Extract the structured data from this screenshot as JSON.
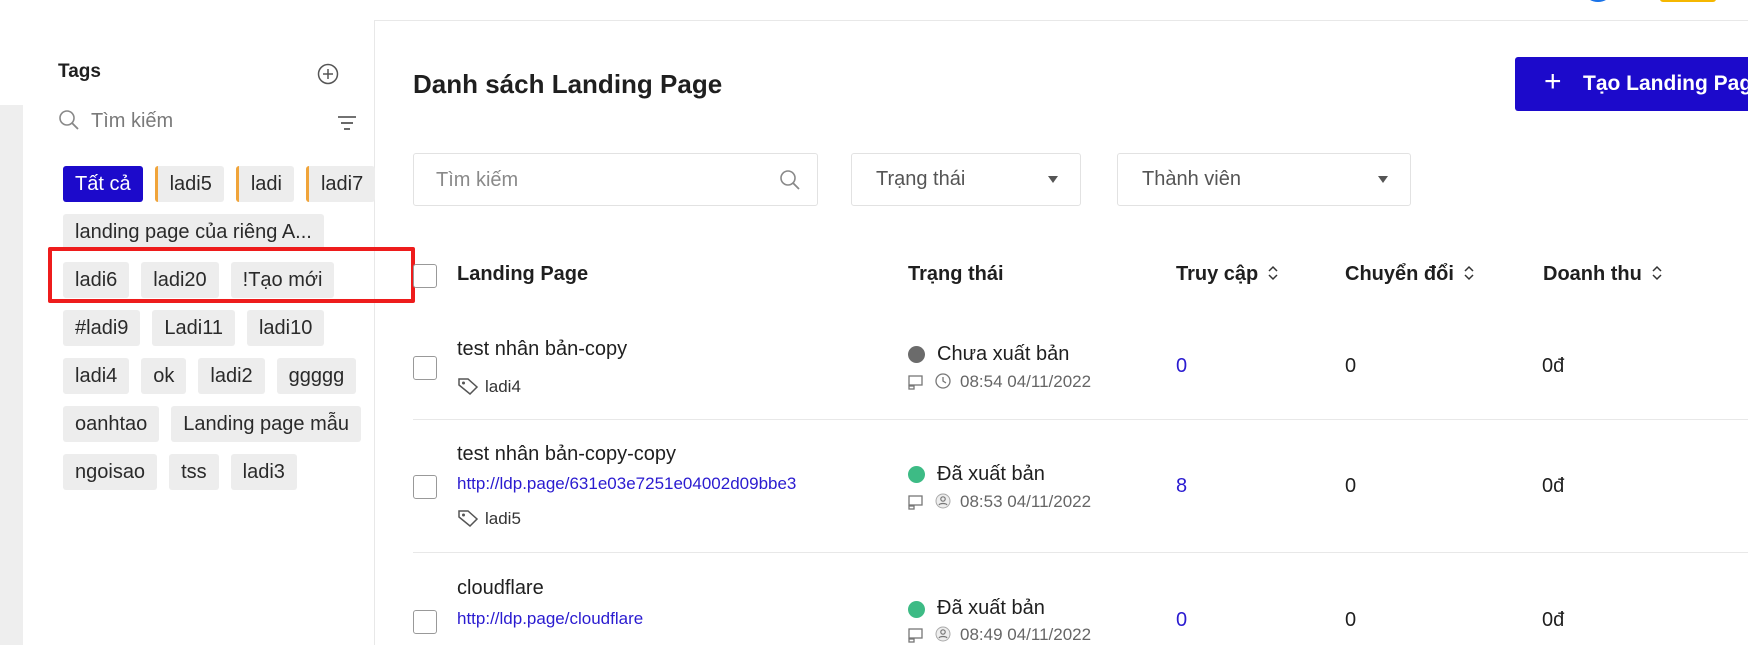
{
  "sidebar": {
    "title": "Tags",
    "search_placeholder": "Tìm kiếm",
    "tags": [
      {
        "label": "Tất cả",
        "active": true
      },
      {
        "label": "ladi5",
        "marked": true
      },
      {
        "label": "ladi",
        "marked": true
      },
      {
        "label": "ladi7",
        "marked": true
      },
      {
        "label": "landing page của riêng A...",
        "wide": true
      },
      {
        "label": "ladi6"
      },
      {
        "label": "ladi20"
      },
      {
        "label": "!Tạo mới"
      },
      {
        "label": "#ladi9"
      },
      {
        "label": "Ladi11"
      },
      {
        "label": "ladi10"
      },
      {
        "label": "ladi4"
      },
      {
        "label": "ok"
      },
      {
        "label": "ladi2"
      },
      {
        "label": "ggggg"
      },
      {
        "label": "oanhtao"
      },
      {
        "label": "Landing page mẫu"
      },
      {
        "label": "ngoisao"
      },
      {
        "label": "tss"
      },
      {
        "label": "ladi3"
      }
    ]
  },
  "header": {
    "title": "Danh sách Landing Page",
    "create_label": "Tạo Landing Page"
  },
  "filters": {
    "search_placeholder": "Tìm kiếm",
    "status_label": "Trạng thái",
    "member_label": "Thành viên"
  },
  "table": {
    "columns": {
      "landing_page": "Landing Page",
      "status": "Trạng thái",
      "visits": "Truy cập",
      "conversions": "Chuyển đổi",
      "revenue": "Doanh thu"
    },
    "rows": [
      {
        "name": "test nhân bản-copy",
        "url": "",
        "tag": "ladi4",
        "status": "Chưa xuất bản",
        "status_color": "#6b6b6b",
        "time": "08:54 04/11/2022",
        "meta_icon": "history-icon",
        "visits": "0",
        "conversions": "0",
        "revenue": "0đ"
      },
      {
        "name": "test nhân bản-copy-copy",
        "url": "http://ldp.page/631e03e7251e04002d09bbe3",
        "tag": "ladi5",
        "status": "Đã xuất bản",
        "status_color": "#3dbb85",
        "time": "08:53 04/11/2022",
        "meta_icon": "user-icon",
        "visits": "8",
        "conversions": "0",
        "revenue": "0đ"
      },
      {
        "name": "cloudflare",
        "url": "http://ldp.page/cloudflare",
        "tag": "",
        "status": "Đã xuất bản",
        "status_color": "#3dbb85",
        "time": "08:49 04/11/2022",
        "meta_icon": "user-icon",
        "visits": "0",
        "conversions": "0",
        "revenue": "0đ"
      }
    ]
  },
  "colors": {
    "accent": "#1c0acb",
    "highlight": "#ee1c1c",
    "tag_marker": "#f0a43a",
    "link": "#2a1bd0"
  }
}
